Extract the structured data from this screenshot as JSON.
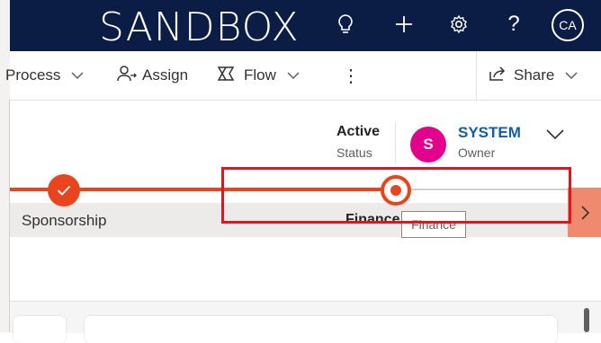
{
  "header": {
    "brand": "SANDBOX",
    "user_initials": "CA"
  },
  "icons": {
    "lightbulb": "lightbulb-icon",
    "plus": "plus-icon",
    "settings": "gear-icon",
    "help": "help-icon"
  },
  "commandbar": {
    "process_label": "Process",
    "assign_label": "Assign",
    "flow_label": "Flow",
    "more_label": "⋮",
    "share_label": "Share"
  },
  "record": {
    "status_value": "Active",
    "status_label": "Status",
    "owner_initial": "S",
    "owner_name": "SYSTEM",
    "owner_label": "Owner"
  },
  "bpf": {
    "stages": [
      {
        "label": "Sponsorship",
        "state": "completed"
      },
      {
        "label": "Finance",
        "state": "active"
      }
    ],
    "tooltip": "Finance"
  },
  "colors": {
    "header_bg": "#0c1d45",
    "accent": "#e8441e",
    "owner_avatar": "#e3008c",
    "link": "#115ea3",
    "highlight": "#e3141b"
  }
}
